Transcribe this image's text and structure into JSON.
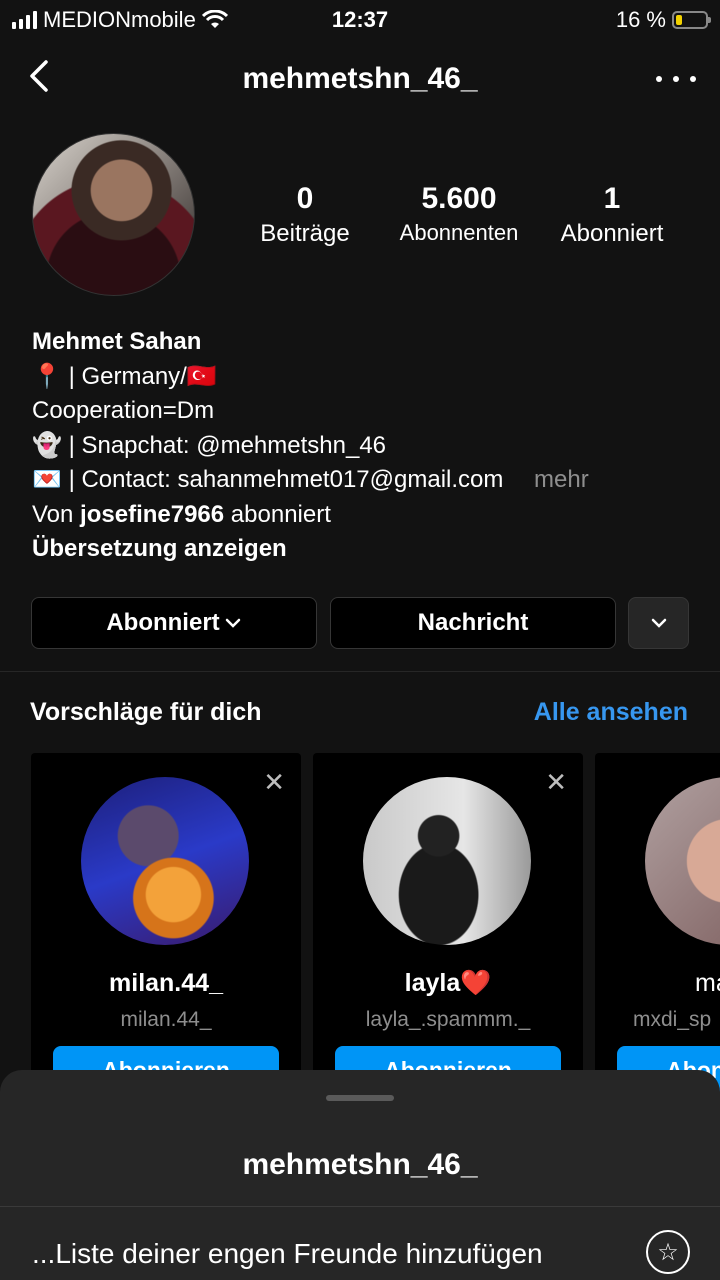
{
  "status_bar": {
    "carrier": "MEDIONmobile",
    "time": "12:37",
    "battery_text": "16 %",
    "battery_level": 0.16
  },
  "header": {
    "username": "mehmetshn_46_"
  },
  "stats": [
    {
      "value": "0",
      "label": "Beiträge"
    },
    {
      "value": "5.600",
      "label": "Abonnenten"
    },
    {
      "value": "1",
      "label": "Abonniert"
    }
  ],
  "bio": {
    "name": "Mehmet Sahan",
    "line1_emoji": "📍",
    "line1_text": "| Germany/",
    "line1_flag": "🇹🇷",
    "line2": "Cooperation=Dm",
    "line3_emoji": "👻",
    "line3_text": "| Snapchat: @mehmetshn_46",
    "line4_emoji": "💌",
    "line4_text": "| Contact: sahanmehmet017@gmail.com",
    "more": "mehr",
    "followed_prefix": "Von ",
    "followed_by": "josefine7966",
    "followed_suffix": " abonniert",
    "translate": "Übersetzung anzeigen"
  },
  "actions": {
    "following_label": "Abonniert",
    "message_label": "Nachricht"
  },
  "suggestions": {
    "title": "Vorschläge für dich",
    "see_all": "Alle ansehen",
    "follow_label": "Abonnieren",
    "cards": [
      {
        "name": "milan.44_",
        "sub": "milan.44_"
      },
      {
        "name": "layla❤️",
        "sub": "layla_.spammm._"
      },
      {
        "name": "ma",
        "sub": "mxdi_sp"
      }
    ]
  },
  "sheet": {
    "title": "mehmetshn_46_",
    "item": "...Liste deiner engen Freunde hinzufügen"
  }
}
